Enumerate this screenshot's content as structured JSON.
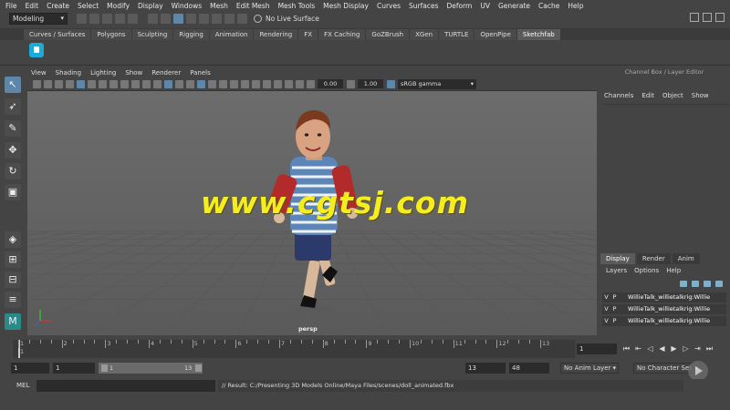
{
  "menubar": [
    "File",
    "Edit",
    "Create",
    "Select",
    "Modify",
    "Display",
    "Windows",
    "Mesh",
    "Edit Mesh",
    "Mesh Tools",
    "Mesh Display",
    "Curves",
    "Surfaces",
    "Deform",
    "UV",
    "Generate",
    "Cache",
    "Help"
  ],
  "status": {
    "mode": "Modeling",
    "live_surface": "No Live Surface"
  },
  "shelf_tabs": [
    "Curves / Surfaces",
    "Polygons",
    "Sculpting",
    "Rigging",
    "Animation",
    "Rendering",
    "FX",
    "FX Caching",
    "GoZBrush",
    "XGen",
    "TURTLE",
    "OpenPipe",
    "Sketchfab"
  ],
  "shelf_active": "Sketchfab",
  "viewport": {
    "menu": [
      "View",
      "Shading",
      "Lighting",
      "Show",
      "Renderer",
      "Panels"
    ],
    "exposure": "0.00",
    "gamma": "1.00",
    "color_space": "sRGB gamma",
    "camera_label": "persp"
  },
  "watermark": "www.cgtsj.com",
  "channel_box": {
    "title": "Channel Box / Layer Editor",
    "menu": [
      "Channels",
      "Edit",
      "Object",
      "Show"
    ]
  },
  "layer_editor": {
    "tabs": [
      "Display",
      "Render",
      "Anim"
    ],
    "menu": [
      "Layers",
      "Options",
      "Help"
    ],
    "layers": [
      {
        "v": "V",
        "p": "P",
        "name": "WillieTalk_willietalkrig:Willie"
      },
      {
        "v": "V",
        "p": "P",
        "name": "WillieTalk_willietalkrig:Willie"
      },
      {
        "v": "V",
        "p": "P",
        "name": "WillieTalk_willietalkrig:Willie"
      }
    ]
  },
  "timeline": {
    "ticks": [
      "1",
      "2",
      "3",
      "4",
      "5",
      "6",
      "7",
      "8",
      "9",
      "10",
      "11",
      "12",
      "13"
    ],
    "current_frame_label": "1",
    "current_frame": "1"
  },
  "range": {
    "start": "1",
    "start_inner": "1",
    "bar_start": "1",
    "bar_end": "13",
    "end_inner": "13",
    "end": "48",
    "anim_layer": "No Anim Layer",
    "char_set": "No Character Set"
  },
  "command": {
    "label": "MEL",
    "result": "// Result: C:/Presenting 3D Models Online/Maya Files/scenes/doll_animated.fbx"
  },
  "colors": {
    "accent": "#5d86a8",
    "sketchfab": "#1caad9",
    "watermark": "#f5ee1c"
  }
}
